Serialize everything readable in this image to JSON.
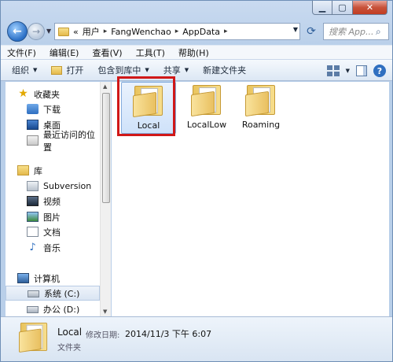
{
  "address": {
    "crumbs": [
      "«",
      "用户",
      "FangWenchao",
      "AppData"
    ],
    "search_placeholder": "搜索 App..."
  },
  "menu": [
    "文件(F)",
    "编辑(E)",
    "查看(V)",
    "工具(T)",
    "帮助(H)"
  ],
  "toolbar": {
    "organize": "组织",
    "open": "打开",
    "include_library": "包含到库中",
    "share": "共享",
    "new_folder": "新建文件夹"
  },
  "nav": {
    "favorites": "收藏夹",
    "downloads": "下载",
    "desktop": "桌面",
    "recent": "最近访问的位置",
    "libraries": "库",
    "subversion": "Subversion",
    "videos": "视频",
    "pictures": "图片",
    "documents": "文档",
    "music": "音乐",
    "computer": "计算机",
    "drive_c": "系统 (C:)",
    "drive_d": "办公 (D:)"
  },
  "files": [
    {
      "name": "Local"
    },
    {
      "name": "LocalLow"
    },
    {
      "name": "Roaming"
    }
  ],
  "details": {
    "name": "Local",
    "modified_label": "修改日期:",
    "modified_value": "2014/11/3 下午 6:07",
    "type": "文件夹"
  },
  "icons": {
    "back": "back-arrow-icon",
    "forward": "forward-arrow-icon",
    "refresh": "refresh-icon",
    "search": "search-icon",
    "help": "help-icon"
  },
  "colors": {
    "highlight": "#d01818",
    "selection": "#cfe2fa"
  }
}
